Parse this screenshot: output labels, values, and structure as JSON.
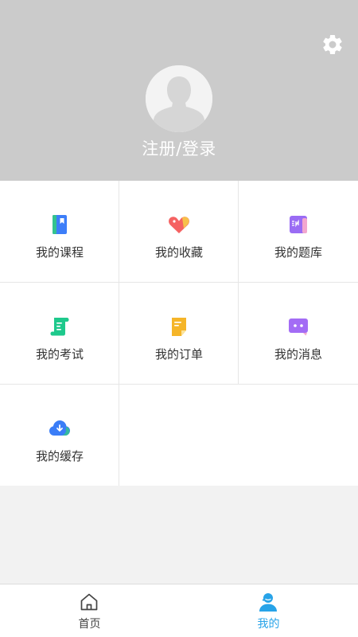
{
  "profile": {
    "login_label": "注册/登录",
    "settings_icon": "gear-icon",
    "avatar_icon": "default-avatar-icon"
  },
  "menu": [
    {
      "label": "我的课程",
      "icon": "course-book-icon",
      "color": "#3d7ef9"
    },
    {
      "label": "我的收藏",
      "icon": "heart-tag-icon",
      "color": "#f56262"
    },
    {
      "label": "我的题库",
      "icon": "question-bank-icon",
      "color": "#9a6cf4"
    },
    {
      "label": "我的考试",
      "icon": "exam-scroll-icon",
      "color": "#1ec98c"
    },
    {
      "label": "我的订单",
      "icon": "order-note-icon",
      "color": "#f5b529"
    },
    {
      "label": "我的消息",
      "icon": "message-bubble-icon",
      "color": "#a36cf5"
    },
    {
      "label": "我的缓存",
      "icon": "cloud-download-icon",
      "color": "#3a7df7"
    }
  ],
  "tabbar": {
    "home_label": "首页",
    "mine_label": "我的",
    "active_color": "#27a3e8",
    "inactive_color": "#444444"
  }
}
